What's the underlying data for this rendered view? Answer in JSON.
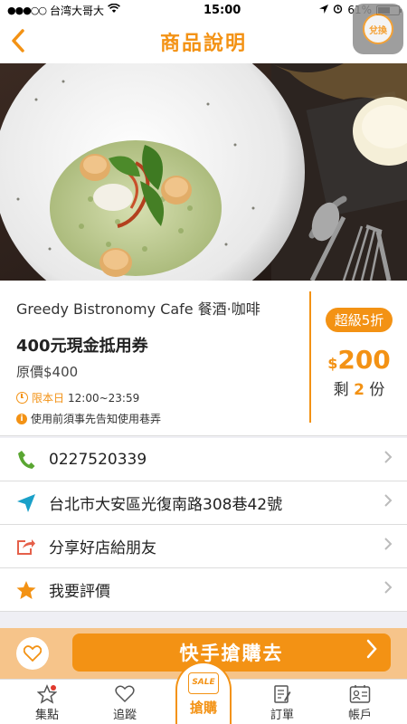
{
  "status_bar": {
    "carrier": "台湾大哥大",
    "time": "15:00",
    "battery": "61%",
    "battery_level": 0.61
  },
  "nav": {
    "back_icon": "chevron-left-icon",
    "title": "商品說明",
    "assistive_label": "兌換"
  },
  "deal": {
    "shop_name": "Greedy Bistronomy Cafe 餐酒·咖啡",
    "title": "400元現金抵用券",
    "original_price": "原價$400",
    "today_label": "限本日",
    "time_range": "12:00~23:59",
    "notice": "使用前須事先告知使用巷弄",
    "sale_badge": "超級5折",
    "currency": "$",
    "price": "200",
    "remain_prefix": "剩",
    "remain_count": "2",
    "remain_suffix": "份"
  },
  "rows": [
    {
      "icon": "phone-icon",
      "label": "0227520339"
    },
    {
      "icon": "location-arrow-icon",
      "label": "台北市大安區光復南路308巷42號"
    },
    {
      "icon": "share-icon",
      "label": "分享好店給朋友"
    },
    {
      "icon": "star-icon",
      "label": "我要評價"
    }
  ],
  "buy_bar": {
    "fav_icon": "heart-icon",
    "button_label": "快手搶購去"
  },
  "tabs": [
    {
      "icon": "star-icon",
      "label": "集點"
    },
    {
      "icon": "heart-icon",
      "label": "追蹤"
    },
    {
      "icon": "sale-tag-icon",
      "label": "搶購",
      "sale_text": "SALE"
    },
    {
      "icon": "order-icon",
      "label": "訂單"
    },
    {
      "icon": "account-icon",
      "label": "帳戶"
    }
  ],
  "colors": {
    "accent": "#f39214",
    "buy_bar_bg": "#f6c48a"
  }
}
